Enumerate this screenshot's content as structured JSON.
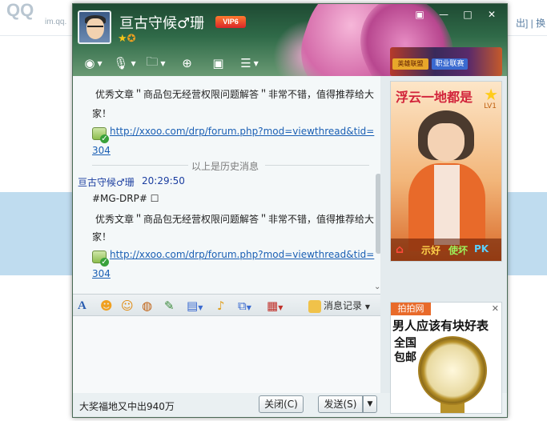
{
  "background": {
    "logo": "QQ",
    "logo_sub": "im.qq.",
    "right_text": "出] | 换"
  },
  "window": {
    "nickname": "亘古守候♂珊",
    "vip_label": "VIP6",
    "controls": [
      "▣",
      "—",
      "□",
      "✕"
    ],
    "toolbar_top": [
      "video-call",
      "voice-call",
      "file-transfer",
      "add-member",
      "remote-desktop",
      "apps"
    ]
  },
  "messages": {
    "msg1_line1": "优秀文章＂商品包无经营权限问题解答＂非常不错，值得推荐给大",
    "msg1_line2": "家！",
    "msg1_link_line1": "http://xxoo.com/drp/forum.php?mod=viewthread&tid=",
    "msg1_link_line2": "304",
    "history_divider": "以上是历史消息",
    "sender": "亘古守候♂珊",
    "time": "20:29:50",
    "msg2_tag": "#MG-DRP# ☐",
    "msg2_line1": "优秀文章＂商品包无经营权限问题解答＂非常不错，值得推荐给大",
    "msg2_line2": "家！",
    "msg2_link_line1": "http://xxoo.com/drp/forum.php?mod=viewthread&tid=",
    "msg2_link_line2": "304"
  },
  "input_toolbar": {
    "font": "A",
    "history_label": "消息记录"
  },
  "bottom": {
    "promo": "大奖福地又中出940万",
    "close_label": "关闭(C)",
    "send_label": "发送(S)",
    "send_arrow": "▼"
  },
  "right": {
    "lol_tag1": "英雄联盟",
    "lol_tag2": "职业联赛",
    "show_title": "浮云一地都是",
    "show_star": "★",
    "show_level": "LV1",
    "show_actions": [
      "示好",
      "使坏",
      "PK"
    ],
    "ad_tag": "拍拍网",
    "ad_close": "✕",
    "ad_headline": "男人应该有块好表",
    "ad_sub": "全国包邮"
  },
  "colors": {
    "title_green": "#2f6a48",
    "link": "#1a5fb4",
    "sender": "#1b3ea0",
    "vip": "#d9262a"
  }
}
